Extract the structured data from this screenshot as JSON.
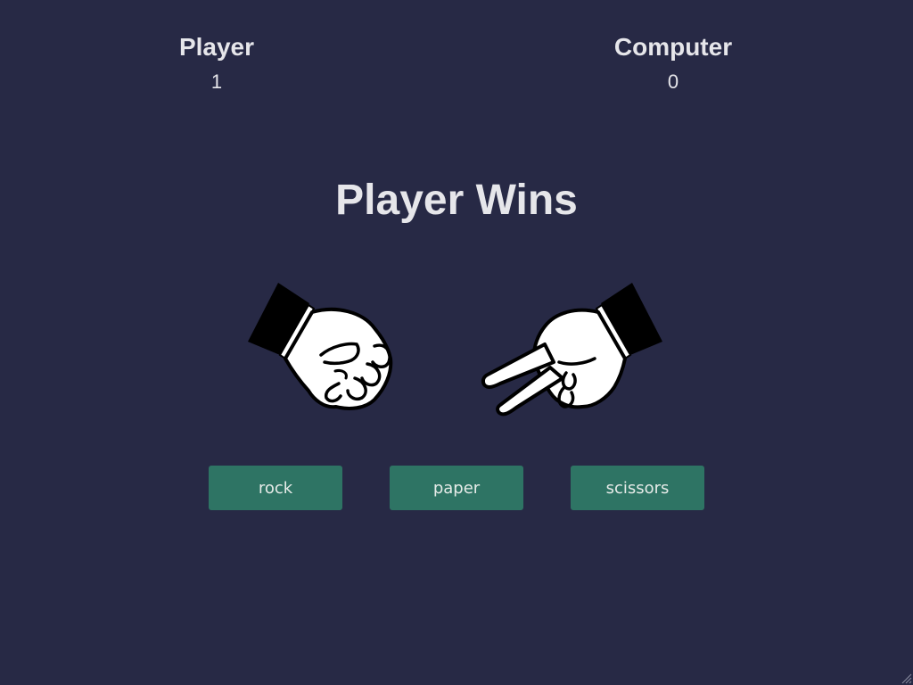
{
  "scoreboard": {
    "player_label": "Player",
    "player_score": "1",
    "computer_label": "Computer",
    "computer_score": "0"
  },
  "result": {
    "text": "Player Wins"
  },
  "hands": {
    "player_choice": "rock-hand-icon",
    "computer_choice": "scissors-hand-icon"
  },
  "buttons": {
    "rock": "rock",
    "paper": "paper",
    "scissors": "scissors"
  },
  "colors": {
    "background": "#272945",
    "text": "#e6e6ea",
    "button": "#2e7464"
  }
}
